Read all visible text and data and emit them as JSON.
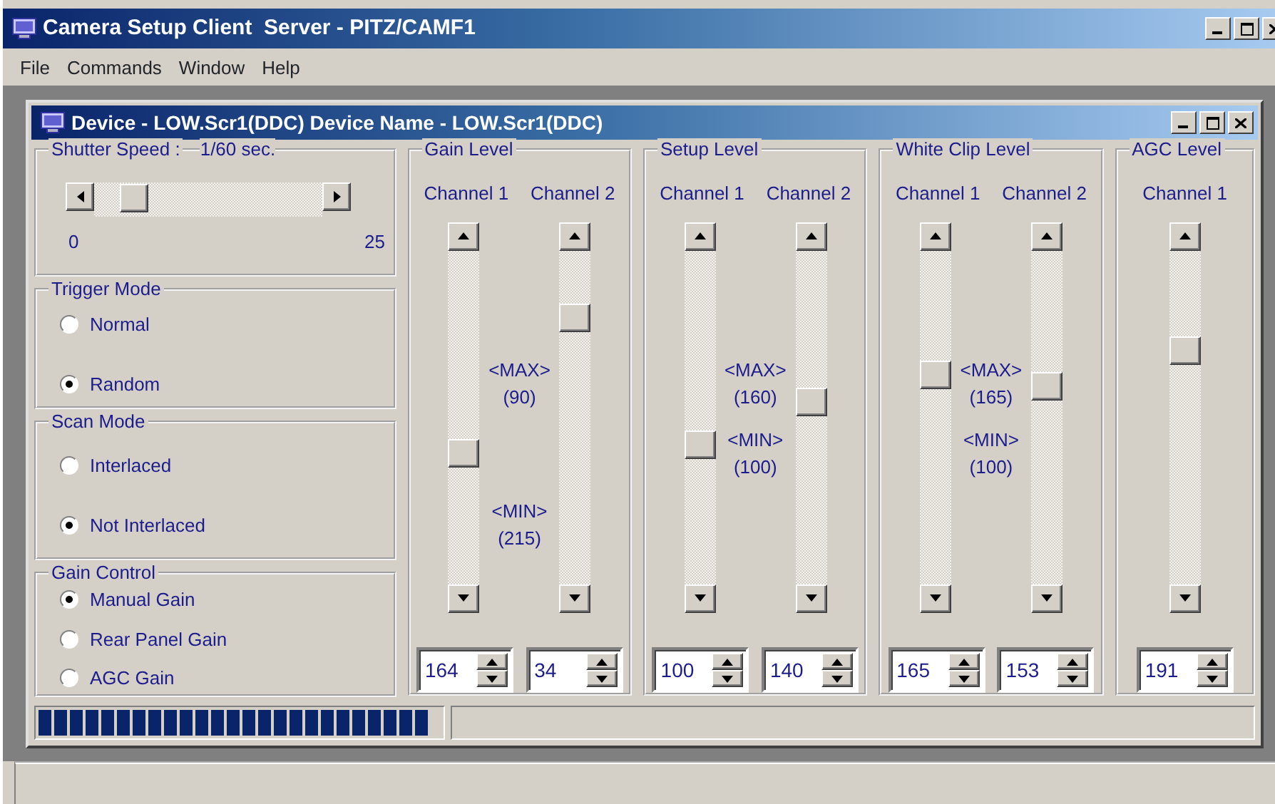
{
  "window": {
    "title": "Camera Setup Client  Server - PITZ/CAMF1"
  },
  "menu": [
    "File",
    "Commands",
    "Window",
    "Help"
  ],
  "device_window": {
    "title": "Device - LOW.Scr1(DDC) Device Name - LOW.Scr1(DDC)"
  },
  "shutter": {
    "label": "Shutter Speed :",
    "value": "1/60 sec.",
    "min": "0",
    "max": "25"
  },
  "radio_groups": [
    {
      "title": "Trigger Mode",
      "options": [
        {
          "label": "Normal",
          "selected": false
        },
        {
          "label": "Random",
          "selected": true
        }
      ]
    },
    {
      "title": "Scan Mode",
      "options": [
        {
          "label": "Interlaced",
          "selected": false
        },
        {
          "label": "Not Interlaced",
          "selected": true
        }
      ]
    },
    {
      "title": "Gain Control",
      "options": [
        {
          "label": "Manual Gain",
          "selected": true
        },
        {
          "label": "Rear Panel Gain",
          "selected": false
        },
        {
          "label": "AGC Gain",
          "selected": false
        }
      ]
    }
  ],
  "level_groups": [
    {
      "title": "Gain Level",
      "channels": [
        {
          "label": "Channel 1",
          "value": "164"
        },
        {
          "label": "Channel 2",
          "value": "34"
        }
      ],
      "max_label": "<MAX>",
      "max_value": "(90)",
      "min_label": "<MIN>",
      "min_value": "(215)"
    },
    {
      "title": "Setup Level",
      "channels": [
        {
          "label": "Channel 1",
          "value": "100"
        },
        {
          "label": "Channel 2",
          "value": "140"
        }
      ],
      "max_label": "<MAX>",
      "max_value": "(160)",
      "min_label": "<MIN>",
      "min_value": "(100)"
    },
    {
      "title": "White Clip Level",
      "channels": [
        {
          "label": "Channel 1",
          "value": "165"
        },
        {
          "label": "Channel 2",
          "value": "153"
        }
      ],
      "max_label": "<MAX>",
      "max_value": "(165)",
      "min_label": "<MIN>",
      "min_value": "(100)"
    },
    {
      "title": "AGC Level",
      "channels": [
        {
          "label": "Channel 1",
          "value": "191"
        }
      ]
    }
  ],
  "progress": {
    "level": 0.97
  }
}
